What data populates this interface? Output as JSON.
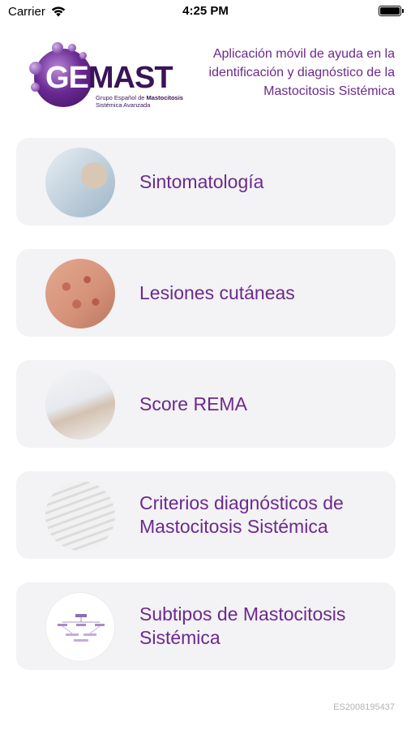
{
  "status_bar": {
    "carrier": "Carrier",
    "time": "4:25 PM",
    "icons": [
      "wifi-icon",
      "battery-icon"
    ]
  },
  "header": {
    "logo": {
      "wordmark_ge": "GE",
      "wordmark_mast": "MAST",
      "subtitle_prefix": "Grupo Español de ",
      "subtitle_bold": "Mastocitosis",
      "subtitle_line2": "Sistémica Avanzada"
    },
    "description": "Aplicación móvil de ayuda en la identificación y diagnóstico de la Mastocitosis Sistémica"
  },
  "menu": {
    "items": [
      {
        "label": "Sintomatología",
        "image": "doctor-patient-photo"
      },
      {
        "label": "Lesiones cutáneas",
        "image": "skin-lesions-photo"
      },
      {
        "label": "Score REMA",
        "image": "doctor-writing-photo"
      },
      {
        "label": "Criterios diagnósticos de Mastocitosis Sistémica",
        "image": "writing-criteria-photo"
      },
      {
        "label": "Subtipos de Mastocitosis Sistémica",
        "image": "subtypes-diagram"
      }
    ]
  },
  "footer": {
    "code": "ES2008195437"
  },
  "colors": {
    "accent_purple": "#6c2a8c",
    "logo_dark": "#3b1458",
    "card_background": "#f3f2f5",
    "footer_text": "#b3b3b3"
  }
}
